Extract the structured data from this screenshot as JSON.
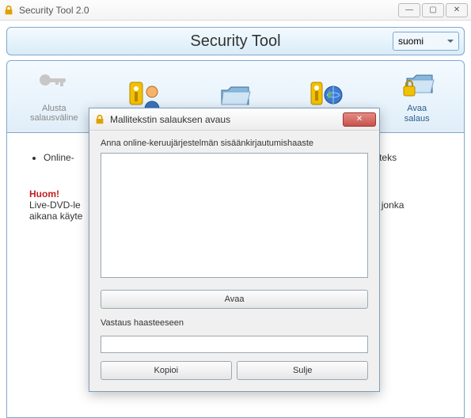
{
  "window": {
    "title": "Security Tool 2.0",
    "minimize": "—",
    "maximize": "▢",
    "close": "✕"
  },
  "header": {
    "title": "Security Tool",
    "language": "suomi"
  },
  "toolbar": {
    "items": [
      {
        "name": "alusta",
        "label": "Alusta\nsalausväline"
      },
      {
        "name": "key-user",
        "label": ""
      },
      {
        "name": "folder",
        "label": ""
      },
      {
        "name": "key-globe",
        "label": ""
      },
      {
        "name": "avaa",
        "label": "Avaa\nsalaus"
      }
    ]
  },
  "content": {
    "bullet1_pre": "Online-",
    "bullet1_post": "vattava malliteks",
    "huom_label": "Huom!",
    "huom_text_pre": "Live-DVD-le",
    "huom_text_mid": "aikana käyte",
    "huom_text_post": "ustunnolla, jonka"
  },
  "dialog": {
    "title": "Mallitekstin salauksen avaus",
    "close": "✕",
    "prompt": "Anna online-keruujärjestelmän sisäänkirjautumishaaste",
    "textarea_value": "",
    "open_label": "Avaa",
    "response_label": "Vastaus haasteeseen",
    "response_value": "",
    "copy_label": "Kopioi",
    "close_label": "Sulje"
  }
}
